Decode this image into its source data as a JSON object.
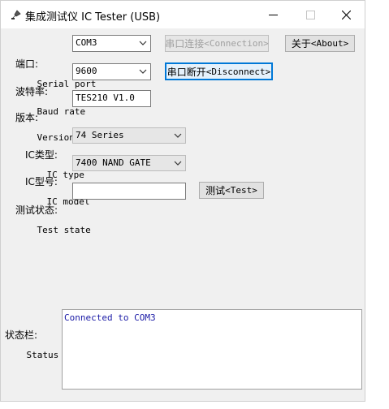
{
  "window": {
    "title": "集成测试仪 IC Tester (USB)",
    "icons": [
      "app-icon",
      "minimize-icon",
      "maximize-icon",
      "close-icon"
    ]
  },
  "serial_port": {
    "label_zh": "端口:",
    "label_en": "Serial port",
    "selected": "COM3"
  },
  "baud_rate": {
    "label_zh": "波特率:",
    "label_en": "Baud rate",
    "selected": "9600"
  },
  "version": {
    "label_zh": "版本:",
    "label_en": "Version",
    "value": "TES210 V1.0"
  },
  "ic_type": {
    "label_zh": "IC类型:",
    "label_en": "IC type",
    "selected": "74 Series"
  },
  "ic_model": {
    "label_zh": "IC型号:",
    "label_en": "IC model",
    "selected": "7400 NAND GATE"
  },
  "test_state": {
    "label_zh": "测试状态:",
    "label_en": "Test state",
    "value": ""
  },
  "buttons": {
    "connect_zh": "串口连接",
    "connect_en": "<Connection>",
    "disconnect_zh": "串口断开",
    "disconnect_en": "<Disconnect>",
    "about_zh": "关于",
    "about_en": "<About>",
    "test_zh": "测试",
    "test_en": "<Test>"
  },
  "status_bar": {
    "label_zh": "状态栏:",
    "label_en": "Status Bar",
    "text": "Connected to COM3"
  },
  "colors": {
    "focus_border": "#0078d7",
    "status_text": "#1a1aa6",
    "window_bg": "#f0f0f0"
  }
}
